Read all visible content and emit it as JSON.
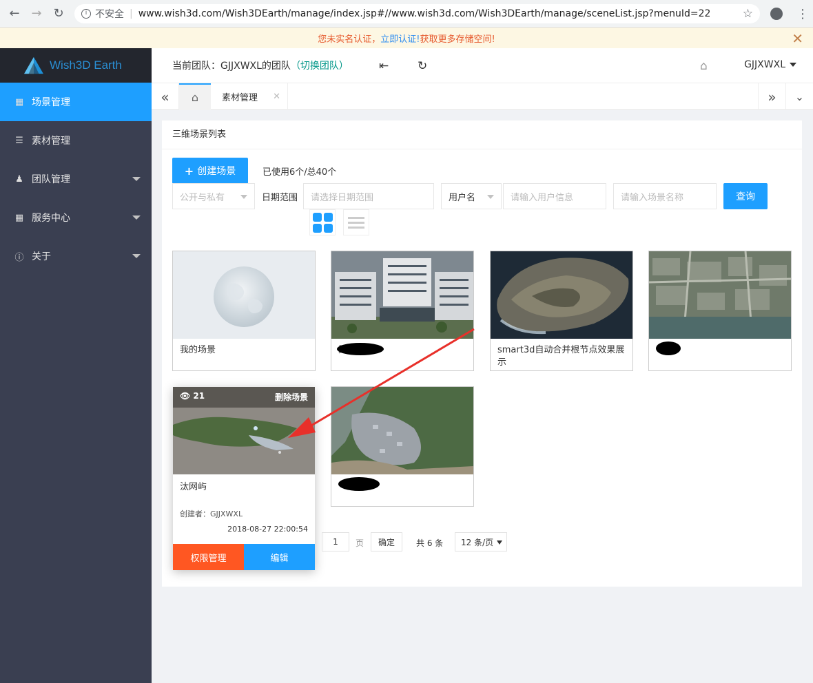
{
  "browser": {
    "security_label": "不安全",
    "url": "www.wish3d.com/Wish3DEarth/manage/index.jsp#//www.wish3d.com/Wish3DEarth/manage/sceneList.jsp?menuId=22"
  },
  "notice": {
    "pre": "您未实名认证，",
    "link": "立即认证!",
    "post": "获取更多存储空间!"
  },
  "sidebar": {
    "brand": "Wish3D Earth",
    "items": [
      {
        "label": "场景管理",
        "active": true
      },
      {
        "label": "素材管理"
      },
      {
        "label": "团队管理"
      },
      {
        "label": "服务中心"
      },
      {
        "label": "关于"
      }
    ]
  },
  "topbar": {
    "team_label": "当前团队：GJJXWXL的团队",
    "switch_label": "（切换团队）",
    "user": "GJJXWXL"
  },
  "tabs": {
    "items": [
      {
        "label": "素材管理"
      }
    ]
  },
  "main": {
    "title": "三维场景列表",
    "create_label": "创建场景",
    "usage": "已使用6个/总40个",
    "filters": {
      "visibility_placeholder": "公开与私有",
      "date_label": "日期范围",
      "date_placeholder": "请选择日期范围",
      "user_select": "用户名",
      "user_placeholder": "请输入用户信息",
      "scene_placeholder": "请输入场景名称",
      "query_label": "查询"
    },
    "scenes": [
      {
        "name": "我的场景"
      },
      {
        "name": "无隐"
      },
      {
        "name": "smart3d自动合并根节点效果展示"
      },
      {
        "name": ""
      },
      {
        "name": "汰网屿",
        "views": "21",
        "delete_label": "删除场景",
        "creator": "创建者：GJJXWXL",
        "date": "2018-08-27 22:00:54",
        "perm_label": "权限管理",
        "edit_label": "编辑"
      },
      {
        "name": ""
      }
    ],
    "pager": {
      "page": "1",
      "page_unit": "页",
      "confirm": "确定",
      "total": "共 6 条",
      "per_page": "12 条/页"
    }
  },
  "colors": {
    "accent": "#1e9fff",
    "danger": "#ff5722",
    "sidebar": "#3a3f51",
    "team_switch": "#009688"
  }
}
